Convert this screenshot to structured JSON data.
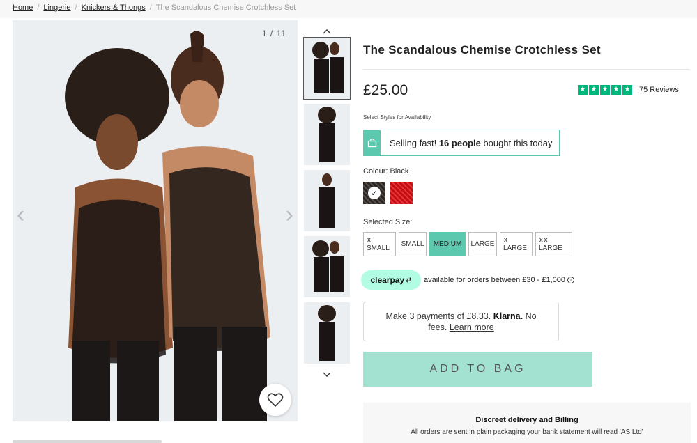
{
  "breadcrumb": {
    "items": [
      "Home",
      "Lingerie",
      "Knickers & Thongs"
    ],
    "current": "The Scandalous Chemise Crotchless Set"
  },
  "gallery": {
    "counter": "1 / 11",
    "thumb_count": 5
  },
  "product": {
    "title": "The Scandalous Chemise Crotchless Set",
    "price": "£25.00",
    "rating_stars": 5,
    "reviews_label": "75 Reviews",
    "availability_note": "Select Styles for Availability"
  },
  "selling_fast": {
    "prefix": "Selling fast!",
    "count": "16 people",
    "suffix": "bought this today"
  },
  "colour": {
    "label": "Colour: Black",
    "options": [
      "black",
      "red"
    ],
    "selected": "black"
  },
  "size": {
    "label": "Selected Size:",
    "options": [
      "X SMALL",
      "SMALL",
      "MEDIUM",
      "LARGE",
      "X LARGE",
      "XX LARGE"
    ],
    "selected": "MEDIUM"
  },
  "clearpay": {
    "badge": "clearpay",
    "text": "available for orders between £30 - £1,000"
  },
  "klarna": {
    "prefix": "Make 3 payments of £8.33.",
    "brand": "Klarna.",
    "suffix": "No fees.",
    "link": "Learn more"
  },
  "cta": {
    "add_to_bag": "ADD TO BAG"
  },
  "delivery": {
    "title": "Discreet delivery and Billing",
    "text": "All orders are sent in plain packaging your bank statement will read 'AS Ltd'"
  },
  "colors": {
    "accent": "#5cc9ae",
    "cta": "#a3e2d0",
    "trustpilot": "#00b67a",
    "clearpay": "#b2fce4"
  }
}
